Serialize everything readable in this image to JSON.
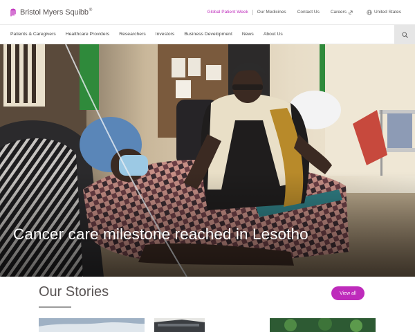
{
  "brand": {
    "name": "Bristol Myers Squibb",
    "trademark": "®",
    "accent_color": "#be2bbb"
  },
  "utility_nav": {
    "global_patient_week": "Global Patient Week",
    "our_medicines": "Our Medicines",
    "contact_us": "Contact Us",
    "careers": "Careers",
    "region": "United States"
  },
  "main_nav": {
    "items": [
      {
        "label": "Patients & Caregivers"
      },
      {
        "label": "Healthcare Providers"
      },
      {
        "label": "Researchers"
      },
      {
        "label": "Investors"
      },
      {
        "label": "Business Development"
      },
      {
        "label": "News"
      },
      {
        "label": "About Us"
      }
    ],
    "search_icon": "search-icon"
  },
  "hero": {
    "title": "Cancer care milestone reached in Lesotho"
  },
  "stories": {
    "heading": "Our Stories",
    "view_all": "View all"
  }
}
